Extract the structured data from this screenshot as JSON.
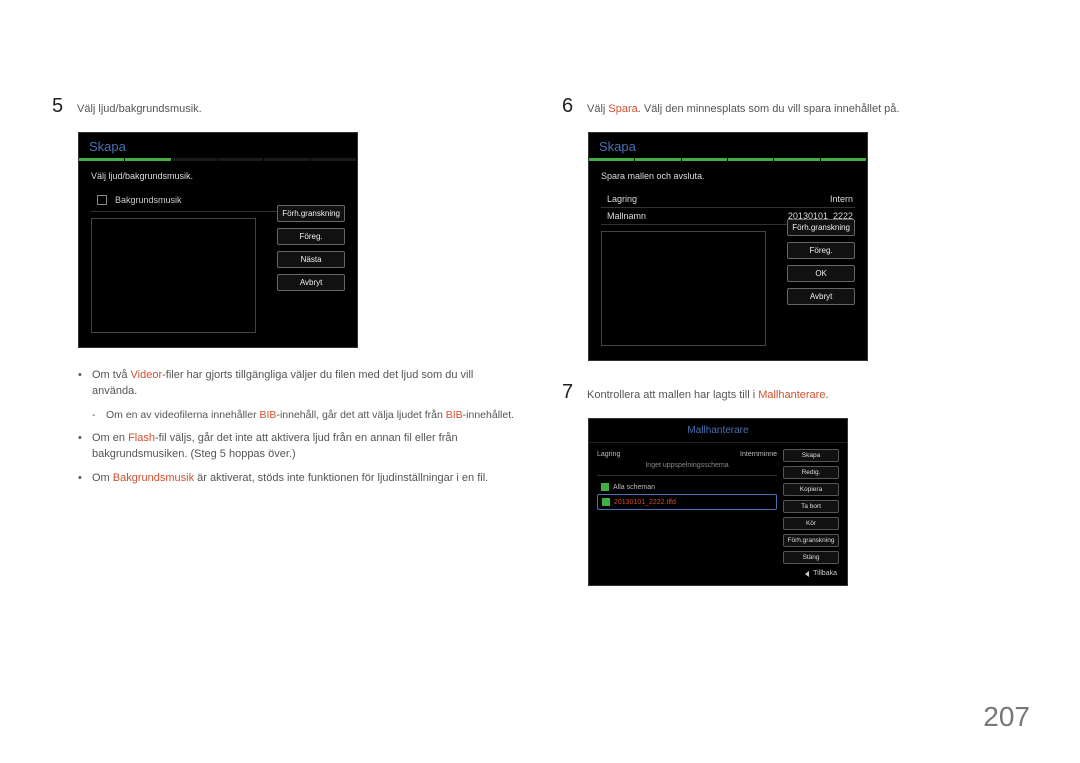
{
  "page_number": "207",
  "left": {
    "step5": {
      "num": "5",
      "text": "Välj ljud/bakgrundsmusik."
    },
    "screen": {
      "title": "Skapa",
      "instruction": "Välj ljud/bakgrundsmusik.",
      "checkbox_label": "Bakgrundsmusik",
      "buttons": {
        "preview": "Förh.granskning",
        "prev": "Föreg.",
        "next": "Nästa",
        "cancel": "Avbryt"
      }
    },
    "bullets": {
      "b1a": "Om två ",
      "b1b": "Videor",
      "b1c": "-filer har gjorts tillgängliga väljer du filen med det ljud som du vill använda.",
      "sub_a": "Om en av videofilerna innehåller ",
      "sub_b": "BIB",
      "sub_c": "-innehåll, går det att välja ljudet från ",
      "sub_d": "BIB",
      "sub_e": "-innehållet.",
      "b2a": "Om en ",
      "b2b": "Flash",
      "b2c": "-fil väljs, går det inte att aktivera ljud från en annan fil eller från bakgrundsmusiken. (Steg 5 hoppas över.)",
      "b3a": "Om ",
      "b3b": "Bakgrundsmusik",
      "b3c": " är aktiverat, stöds inte funktionen för ljudinställningar i en fil."
    }
  },
  "right": {
    "step6": {
      "num": "6",
      "text_a": "Välj ",
      "text_b": "Spara",
      "text_c": ". Välj den minnesplats som du vill spara innehållet på."
    },
    "screen": {
      "title": "Skapa",
      "instruction": "Spara mallen och avsluta.",
      "storage_label": "Lagring",
      "storage_value": "Intern",
      "name_label": "Mallnamn",
      "name_value": "20130101_2222",
      "buttons": {
        "preview": "Förh.granskning",
        "prev": "Föreg.",
        "ok": "OK",
        "cancel": "Avbryt"
      }
    },
    "step7": {
      "num": "7",
      "text_a": "Kontrollera att mallen har lagts till i ",
      "text_b": "Mallhanterare",
      "text_c": "."
    },
    "mgr": {
      "title": "Mallhanterare",
      "storage_label": "Lagring",
      "storage_value": "Internminne",
      "sub": "Inget uppspelningsschema",
      "row_all": "Alla scheman",
      "row_file": "20130101_2222.tlfd",
      "buttons": {
        "create": "Skapa",
        "edit": "Redig.",
        "copy": "Kopiera",
        "delete": "Ta bort",
        "run": "Kör",
        "preview": "Förh.granskning",
        "close": "Stäng"
      },
      "back": "Tillbaka"
    }
  }
}
